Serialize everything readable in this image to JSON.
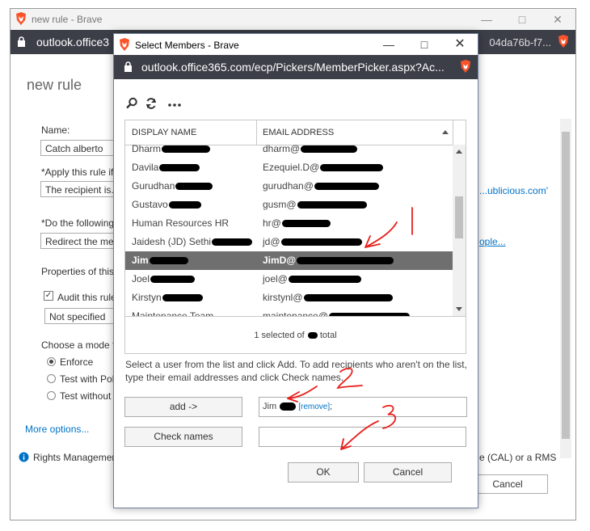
{
  "colors": {
    "titlebar_dark": "#3d3f48",
    "selection": "#6f6f6f",
    "link": "#0072c6",
    "annotation": "#e8201c",
    "brave": "#fb542b"
  },
  "background_window": {
    "title": "new rule - Brave",
    "url": "outlook.office3",
    "url_tail": "04da76b-f7...",
    "heading": "new rule",
    "name_label": "Name:",
    "name_value": "Catch alberto",
    "apply_label": "*Apply this rule if",
    "apply_value": "The recipient is...",
    "apply_tail": "...ublicious.com'",
    "do_label": "*Do the following",
    "do_value": "Redirect the me",
    "do_tail": "ople...",
    "properties_label": "Properties of this",
    "audit_label": "Audit this rule",
    "severity_value": "Not specified",
    "mode_label": "Choose a mode f",
    "mode_options": [
      "Enforce",
      "Test with Pol",
      "Test without"
    ],
    "more_options": "More options...",
    "rights_text": "Rights Managemen",
    "rights_tail": "e (CAL) or a RMS",
    "cancel_label": "Cancel"
  },
  "dialog": {
    "title": "Select Members - Brave",
    "url": "outlook.office365.com/ecp/Pickers/MemberPicker.aspx?Ac...",
    "columns": {
      "display_name": "DISPLAY NAME",
      "email": "EMAIL ADDRESS"
    },
    "rows": [
      {
        "name": "Dharm",
        "email": "dharm@",
        "selected": false
      },
      {
        "name": "Davila",
        "email": "Ezequiel.D@",
        "selected": false
      },
      {
        "name": "Gurudhan",
        "email": "gurudhan@",
        "selected": false
      },
      {
        "name": "Gustavo",
        "email": "gusm@",
        "selected": false
      },
      {
        "name": "Human Resources HR",
        "email": "hr@",
        "selected": false
      },
      {
        "name": "Jaidesh (JD) Sethi",
        "email": "jd@",
        "selected": false
      },
      {
        "name": "Jim",
        "email": "JimD@",
        "selected": true
      },
      {
        "name": "Joel",
        "email": "joel@",
        "selected": false
      },
      {
        "name": "Kirstyn",
        "email": "kirstynl@",
        "selected": false
      },
      {
        "name": "Maintenance Team",
        "email": "maintenance@",
        "selected": false
      }
    ],
    "footer": "1 selected of",
    "footer_tail": "total",
    "instructions": "Select a user from the list and click Add. To add recipients who aren't on the list, type their email addresses and click Check names.",
    "add_label": "add ->",
    "check_names_label": "Check names",
    "added_value": "Jim",
    "remove_label": "[remove]",
    "added_suffix": ";",
    "ok_label": "OK",
    "cancel_label": "Cancel"
  },
  "annotations": [
    "1",
    "2",
    "3"
  ]
}
